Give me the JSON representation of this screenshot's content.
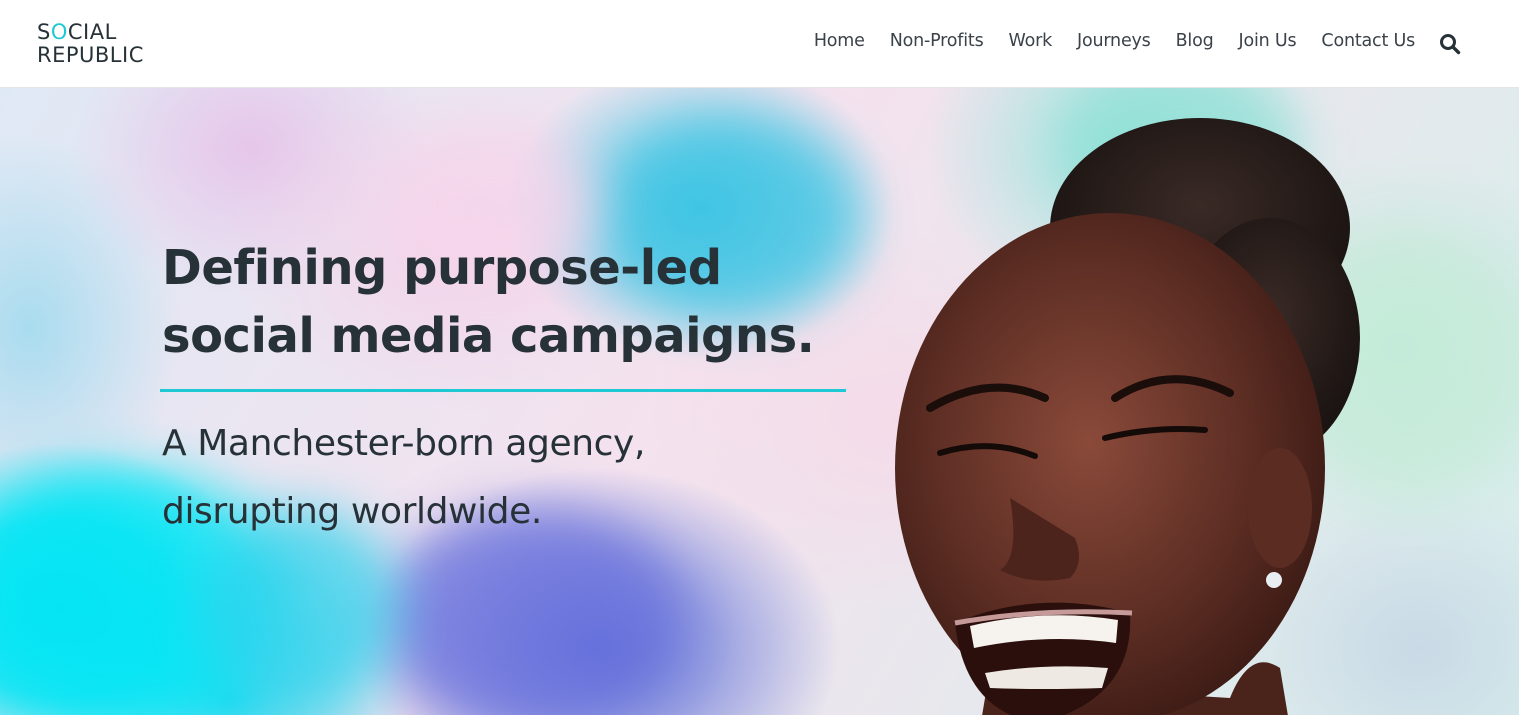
{
  "brand": {
    "logo_line1_a": "S",
    "logo_line1_b": "O",
    "logo_line1_c": "CIAL",
    "logo_line2": "REPUBLIC",
    "accent_color": "#1fc9d4",
    "text_color": "#263238"
  },
  "nav": {
    "items": [
      {
        "label": "Home"
      },
      {
        "label": "Non-Profits"
      },
      {
        "label": "Work"
      },
      {
        "label": "Journeys"
      },
      {
        "label": "Blog"
      },
      {
        "label": "Join Us"
      },
      {
        "label": "Contact Us"
      }
    ],
    "search_icon": "search-icon"
  },
  "hero": {
    "headline_line1": "Defining purpose-led",
    "headline_line2": "social media campaigns.",
    "subhead_line1": "A Manchester-born agency,",
    "subhead_line2": "disrupting worldwide.",
    "image": "smiling-woman-with-colorful-smoke-background"
  }
}
